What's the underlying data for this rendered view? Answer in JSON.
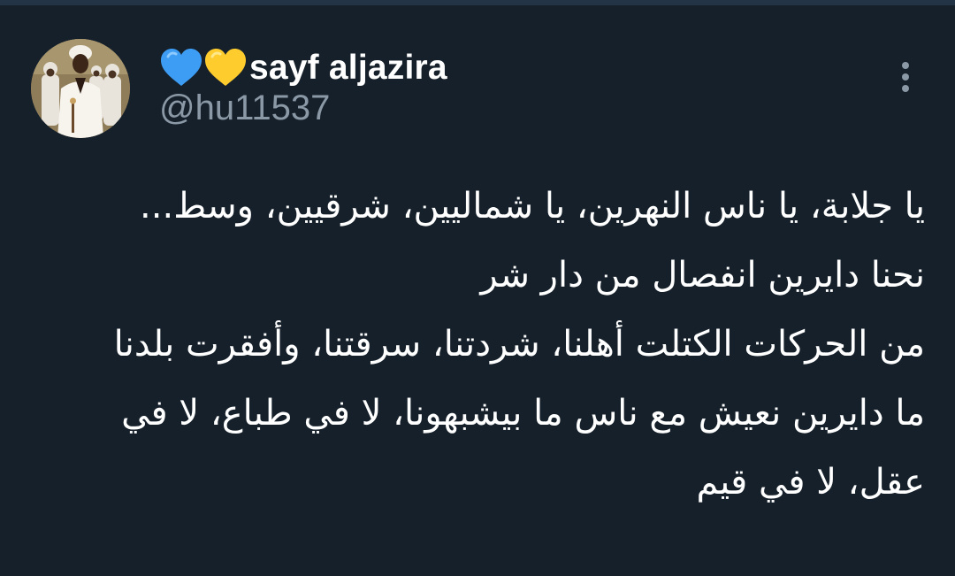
{
  "author": {
    "display_name": "sayf aljazira",
    "handle": "@hu11537",
    "name_emojis": [
      "blue-heart",
      "yellow-heart"
    ],
    "avatar": "men-in-white-robes-and-turbans"
  },
  "menu": {
    "icon": "vertical-ellipsis-icon"
  },
  "tweet": {
    "lines": [
      "يا جلابة، يا ناس النهرين، يا شماليين، شرقيين، وسط...",
      "نحنا دايرين انفصال من دار شر",
      "من الحركات الكتلت أهلنا، شردتنا، سرقتنا، وأفقرت بلدنا",
      "ما دايرين نعيش مع ناس ما بيشبهونا، لا في طباع، لا في عقل، لا في قيم"
    ]
  },
  "colors": {
    "background": "#15202b",
    "text_primary": "#ffffff",
    "text_secondary": "#8b98a5",
    "heart_blue": "#3d9cf3",
    "heart_yellow": "#ffcc2e"
  }
}
